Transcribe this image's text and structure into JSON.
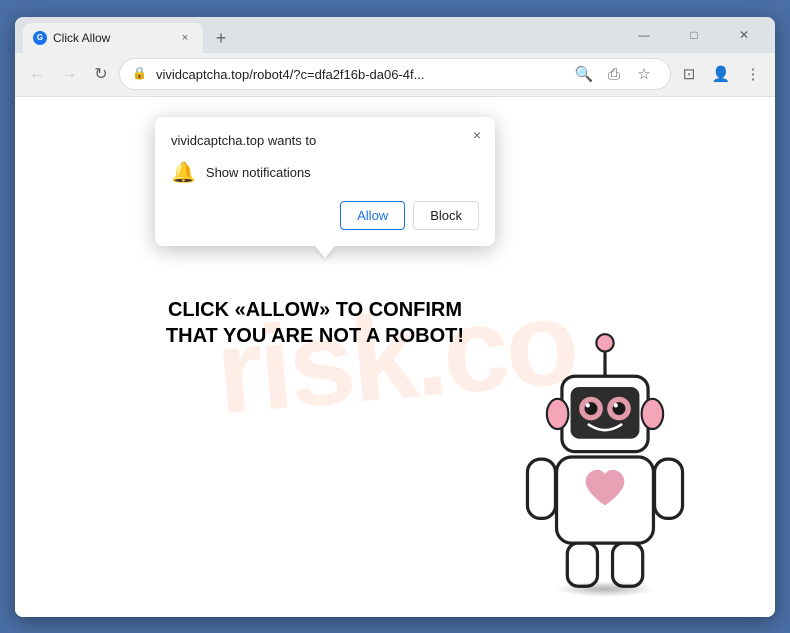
{
  "browser": {
    "tab": {
      "favicon": "G",
      "title": "Click Allow",
      "close_label": "×"
    },
    "new_tab_label": "+",
    "window_controls": {
      "minimize": "—",
      "maximize": "□",
      "close": "✕"
    },
    "toolbar": {
      "back_icon": "←",
      "forward_icon": "→",
      "refresh_icon": "↻",
      "lock_icon": "🔒",
      "url": "vividcaptcha.top/robot4/?c=dfa2f16b-da06-4f...",
      "search_icon": "🔍",
      "share_icon": "⎙",
      "bookmark_icon": "☆",
      "split_icon": "⊡",
      "profile_icon": "👤",
      "menu_icon": "⋮"
    }
  },
  "popup": {
    "title": "vividcaptcha.top wants to",
    "close_label": "×",
    "bell_icon": "🔔",
    "notification_label": "Show notifications",
    "allow_label": "Allow",
    "block_label": "Block"
  },
  "page": {
    "cta_text": "CLICK «ALLOW» TO CONFIRM THAT YOU ARE NOT A ROBOT!",
    "watermark": "risk.co"
  }
}
